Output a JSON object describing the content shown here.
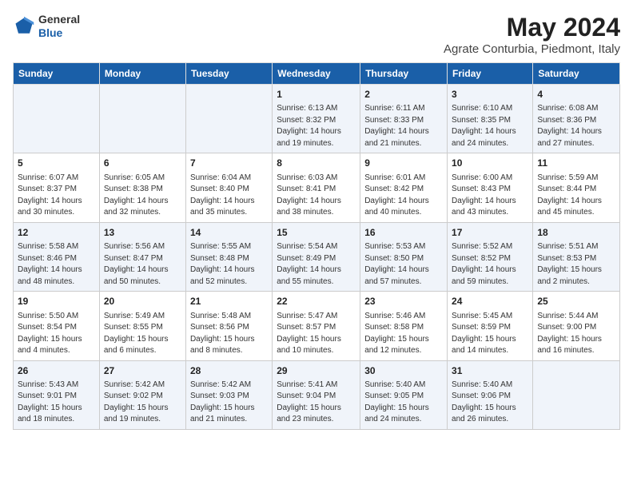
{
  "header": {
    "logo": {
      "general": "General",
      "blue": "Blue"
    },
    "title": "May 2024",
    "location": "Agrate Conturbia, Piedmont, Italy"
  },
  "weekdays": [
    "Sunday",
    "Monday",
    "Tuesday",
    "Wednesday",
    "Thursday",
    "Friday",
    "Saturday"
  ],
  "weeks": [
    [
      null,
      null,
      null,
      {
        "day": 1,
        "sunrise": "6:13 AM",
        "sunset": "8:32 PM",
        "daylight": "14 hours and 19 minutes."
      },
      {
        "day": 2,
        "sunrise": "6:11 AM",
        "sunset": "8:33 PM",
        "daylight": "14 hours and 21 minutes."
      },
      {
        "day": 3,
        "sunrise": "6:10 AM",
        "sunset": "8:35 PM",
        "daylight": "14 hours and 24 minutes."
      },
      {
        "day": 4,
        "sunrise": "6:08 AM",
        "sunset": "8:36 PM",
        "daylight": "14 hours and 27 minutes."
      }
    ],
    [
      {
        "day": 5,
        "sunrise": "6:07 AM",
        "sunset": "8:37 PM",
        "daylight": "14 hours and 30 minutes."
      },
      {
        "day": 6,
        "sunrise": "6:05 AM",
        "sunset": "8:38 PM",
        "daylight": "14 hours and 32 minutes."
      },
      {
        "day": 7,
        "sunrise": "6:04 AM",
        "sunset": "8:40 PM",
        "daylight": "14 hours and 35 minutes."
      },
      {
        "day": 8,
        "sunrise": "6:03 AM",
        "sunset": "8:41 PM",
        "daylight": "14 hours and 38 minutes."
      },
      {
        "day": 9,
        "sunrise": "6:01 AM",
        "sunset": "8:42 PM",
        "daylight": "14 hours and 40 minutes."
      },
      {
        "day": 10,
        "sunrise": "6:00 AM",
        "sunset": "8:43 PM",
        "daylight": "14 hours and 43 minutes."
      },
      {
        "day": 11,
        "sunrise": "5:59 AM",
        "sunset": "8:44 PM",
        "daylight": "14 hours and 45 minutes."
      }
    ],
    [
      {
        "day": 12,
        "sunrise": "5:58 AM",
        "sunset": "8:46 PM",
        "daylight": "14 hours and 48 minutes."
      },
      {
        "day": 13,
        "sunrise": "5:56 AM",
        "sunset": "8:47 PM",
        "daylight": "14 hours and 50 minutes."
      },
      {
        "day": 14,
        "sunrise": "5:55 AM",
        "sunset": "8:48 PM",
        "daylight": "14 hours and 52 minutes."
      },
      {
        "day": 15,
        "sunrise": "5:54 AM",
        "sunset": "8:49 PM",
        "daylight": "14 hours and 55 minutes."
      },
      {
        "day": 16,
        "sunrise": "5:53 AM",
        "sunset": "8:50 PM",
        "daylight": "14 hours and 57 minutes."
      },
      {
        "day": 17,
        "sunrise": "5:52 AM",
        "sunset": "8:52 PM",
        "daylight": "14 hours and 59 minutes."
      },
      {
        "day": 18,
        "sunrise": "5:51 AM",
        "sunset": "8:53 PM",
        "daylight": "15 hours and 2 minutes."
      }
    ],
    [
      {
        "day": 19,
        "sunrise": "5:50 AM",
        "sunset": "8:54 PM",
        "daylight": "15 hours and 4 minutes."
      },
      {
        "day": 20,
        "sunrise": "5:49 AM",
        "sunset": "8:55 PM",
        "daylight": "15 hours and 6 minutes."
      },
      {
        "day": 21,
        "sunrise": "5:48 AM",
        "sunset": "8:56 PM",
        "daylight": "15 hours and 8 minutes."
      },
      {
        "day": 22,
        "sunrise": "5:47 AM",
        "sunset": "8:57 PM",
        "daylight": "15 hours and 10 minutes."
      },
      {
        "day": 23,
        "sunrise": "5:46 AM",
        "sunset": "8:58 PM",
        "daylight": "15 hours and 12 minutes."
      },
      {
        "day": 24,
        "sunrise": "5:45 AM",
        "sunset": "8:59 PM",
        "daylight": "15 hours and 14 minutes."
      },
      {
        "day": 25,
        "sunrise": "5:44 AM",
        "sunset": "9:00 PM",
        "daylight": "15 hours and 16 minutes."
      }
    ],
    [
      {
        "day": 26,
        "sunrise": "5:43 AM",
        "sunset": "9:01 PM",
        "daylight": "15 hours and 18 minutes."
      },
      {
        "day": 27,
        "sunrise": "5:42 AM",
        "sunset": "9:02 PM",
        "daylight": "15 hours and 19 minutes."
      },
      {
        "day": 28,
        "sunrise": "5:42 AM",
        "sunset": "9:03 PM",
        "daylight": "15 hours and 21 minutes."
      },
      {
        "day": 29,
        "sunrise": "5:41 AM",
        "sunset": "9:04 PM",
        "daylight": "15 hours and 23 minutes."
      },
      {
        "day": 30,
        "sunrise": "5:40 AM",
        "sunset": "9:05 PM",
        "daylight": "15 hours and 24 minutes."
      },
      {
        "day": 31,
        "sunrise": "5:40 AM",
        "sunset": "9:06 PM",
        "daylight": "15 hours and 26 minutes."
      },
      null
    ]
  ]
}
